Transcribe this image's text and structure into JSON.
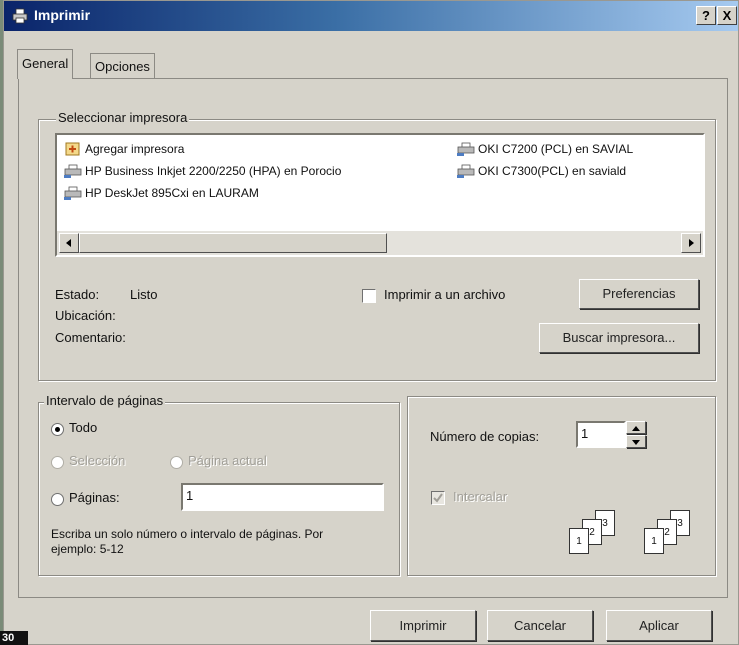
{
  "window": {
    "title": "Imprimir",
    "help_label": "?",
    "close_label": "X"
  },
  "tabs": [
    {
      "label": "General"
    },
    {
      "label": "Opciones"
    }
  ],
  "printer_group": {
    "title": "Seleccionar impresora",
    "printers": [
      {
        "label": "Agregar impresora",
        "icon": "add-printer-icon"
      },
      {
        "label": "HP Business Inkjet 2200/2250 (HPA) en Porocio",
        "icon": "printer-icon"
      },
      {
        "label": "HP DeskJet 895Cxi en LAURAM",
        "icon": "printer-icon"
      },
      {
        "label": "OKI C7200 (PCL) en SAVIAL",
        "icon": "printer-icon"
      },
      {
        "label": "OKI C7300(PCL) en saviald",
        "icon": "printer-icon"
      }
    ],
    "status_label": "Estado:",
    "status_value": "Listo",
    "location_label": "Ubicación:",
    "comment_label": "Comentario:",
    "print_to_file_label": "Imprimir a un archivo",
    "preferences_label": "Preferencias",
    "find_printer_label": "Buscar impresora..."
  },
  "page_range": {
    "title": "Intervalo de páginas",
    "all_label": "Todo",
    "selection_label": "Selección",
    "current_page_label": "Página actual",
    "pages_label": "Páginas:",
    "pages_value": "1",
    "hint": "Escriba un solo número o intervalo de páginas. Por ejemplo: 5-12"
  },
  "copies": {
    "label": "Número de copias:",
    "value": "1",
    "collate_label": "Intercalar",
    "page_numbers": [
      "1",
      "2",
      "3"
    ]
  },
  "footer": {
    "print_label": "Imprimir",
    "cancel_label": "Cancelar",
    "apply_label": "Aplicar"
  },
  "badge": "30"
}
